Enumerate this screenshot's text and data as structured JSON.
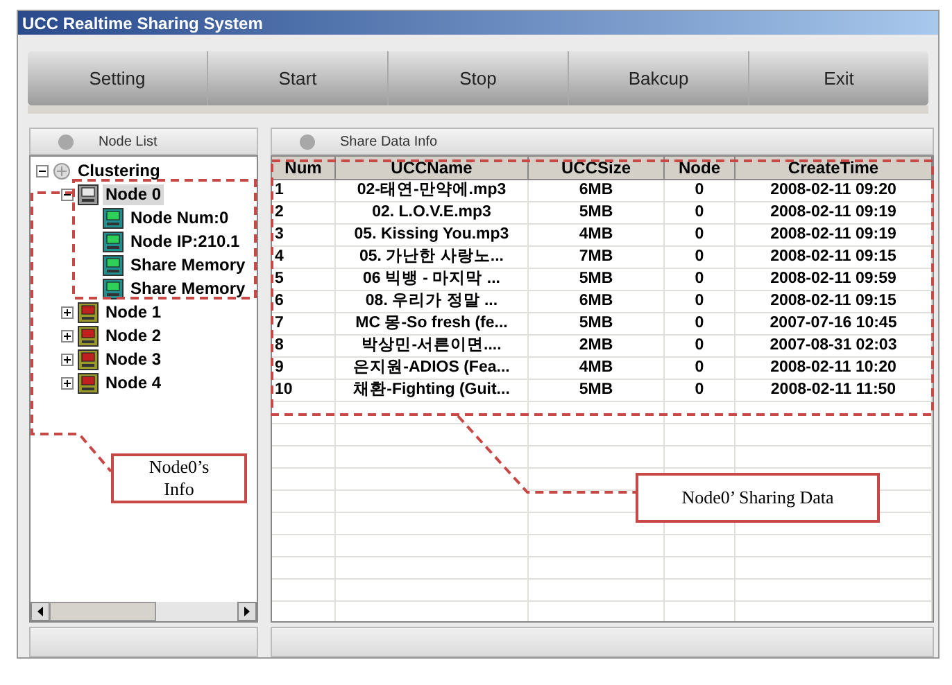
{
  "window": {
    "title": "UCC Realtime Sharing System"
  },
  "toolbar": [
    "Setting",
    "Start",
    "Stop",
    "Bakcup",
    "Exit"
  ],
  "node_list": {
    "title": "Node List",
    "tree": [
      {
        "label": "Clustering",
        "kind": "root",
        "expanded": true,
        "selected": false,
        "children": [
          {
            "label": "Node 0",
            "kind": "node",
            "expanded": true,
            "selected": true,
            "children": [
              {
                "label": "Node Num:0",
                "kind": "info",
                "selected": false
              },
              {
                "label": "Node IP:210.1",
                "kind": "info",
                "selected": false
              },
              {
                "label": "Share Memory",
                "kind": "info",
                "selected": false
              },
              {
                "label": "Share Memory",
                "kind": "info",
                "selected": false
              }
            ]
          },
          {
            "label": "Node 1",
            "kind": "node",
            "expanded": false,
            "selected": false
          },
          {
            "label": "Node 2",
            "kind": "node",
            "expanded": false,
            "selected": false
          },
          {
            "label": "Node 3",
            "kind": "node",
            "expanded": false,
            "selected": false
          },
          {
            "label": "Node 4",
            "kind": "node",
            "expanded": false,
            "selected": false
          }
        ]
      }
    ]
  },
  "share_data": {
    "title": "Share Data Info",
    "columns": [
      "Num",
      "UCCName",
      "UCCSize",
      "Node",
      "CreateTime"
    ],
    "rows": [
      [
        "1",
        "02-태연-만약에.mp3",
        "6MB",
        "0",
        "2008-02-11 09:20"
      ],
      [
        "2",
        "02. L.O.V.E.mp3",
        "5MB",
        "0",
        "2008-02-11 09:19"
      ],
      [
        "3",
        "05. Kissing You.mp3",
        "4MB",
        "0",
        "2008-02-11 09:19"
      ],
      [
        "4",
        "05. 가난한 사랑노...",
        "7MB",
        "0",
        "2008-02-11 09:15"
      ],
      [
        "5",
        "06 빅뱅 - 마지막 ...",
        "5MB",
        "0",
        "2008-02-11 09:59"
      ],
      [
        "6",
        "08. 우리가 정말 ...",
        "6MB",
        "0",
        "2008-02-11 09:15"
      ],
      [
        "7",
        "MC 몽-So fresh (fe...",
        "5MB",
        "0",
        "2007-07-16 10:45"
      ],
      [
        "8",
        "박상민-서른이면....",
        "2MB",
        "0",
        "2007-08-31 02:03"
      ],
      [
        "9",
        "은지원-ADIOS (Fea...",
        "4MB",
        "0",
        "2008-02-11 10:20"
      ],
      [
        "10",
        "채환-Fighting (Guit...",
        "5MB",
        "0",
        "2008-02-11 11:50"
      ]
    ]
  },
  "callouts": [
    "Node0’s Info",
    "Node0’ Sharing Data"
  ]
}
